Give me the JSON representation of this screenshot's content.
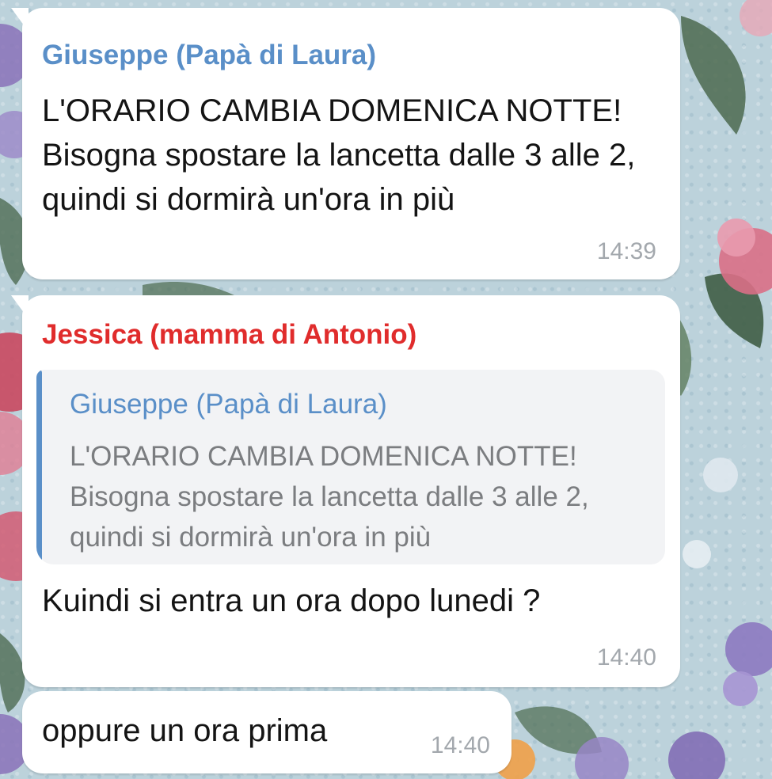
{
  "chat": {
    "messages": [
      {
        "sender": "Giuseppe (Papà di Laura)",
        "sender_color": "#5a8fc8",
        "text": "L'ORARIO CAMBIA DOMENICA NOTTE! Bisogna spostare la lancetta dalle 3 alle 2, quindi si dormirà un'ora in più",
        "time": "14:39"
      },
      {
        "sender": "Jessica (mamma di Antonio)",
        "sender_color": "#e02c2c",
        "reply": {
          "sender": "Giuseppe (Papà di Laura)",
          "text": "L'ORARIO CAMBIA DOMENICA NOTTE! Bisogna spostare la lancetta dalle 3 alle 2, quindi si dormirà un'ora in più"
        },
        "text": "Kuindi si entra un ora dopo lunedi ?",
        "time": "14:40"
      },
      {
        "text": "oppure un ora prima",
        "time": "14:40"
      }
    ]
  },
  "theme": {
    "bubble_color": "#ffffff",
    "reply_bar_color": "#5a8fc8",
    "time_color": "#a3a8ad",
    "wallpaper": "floral pattern on light blue"
  }
}
